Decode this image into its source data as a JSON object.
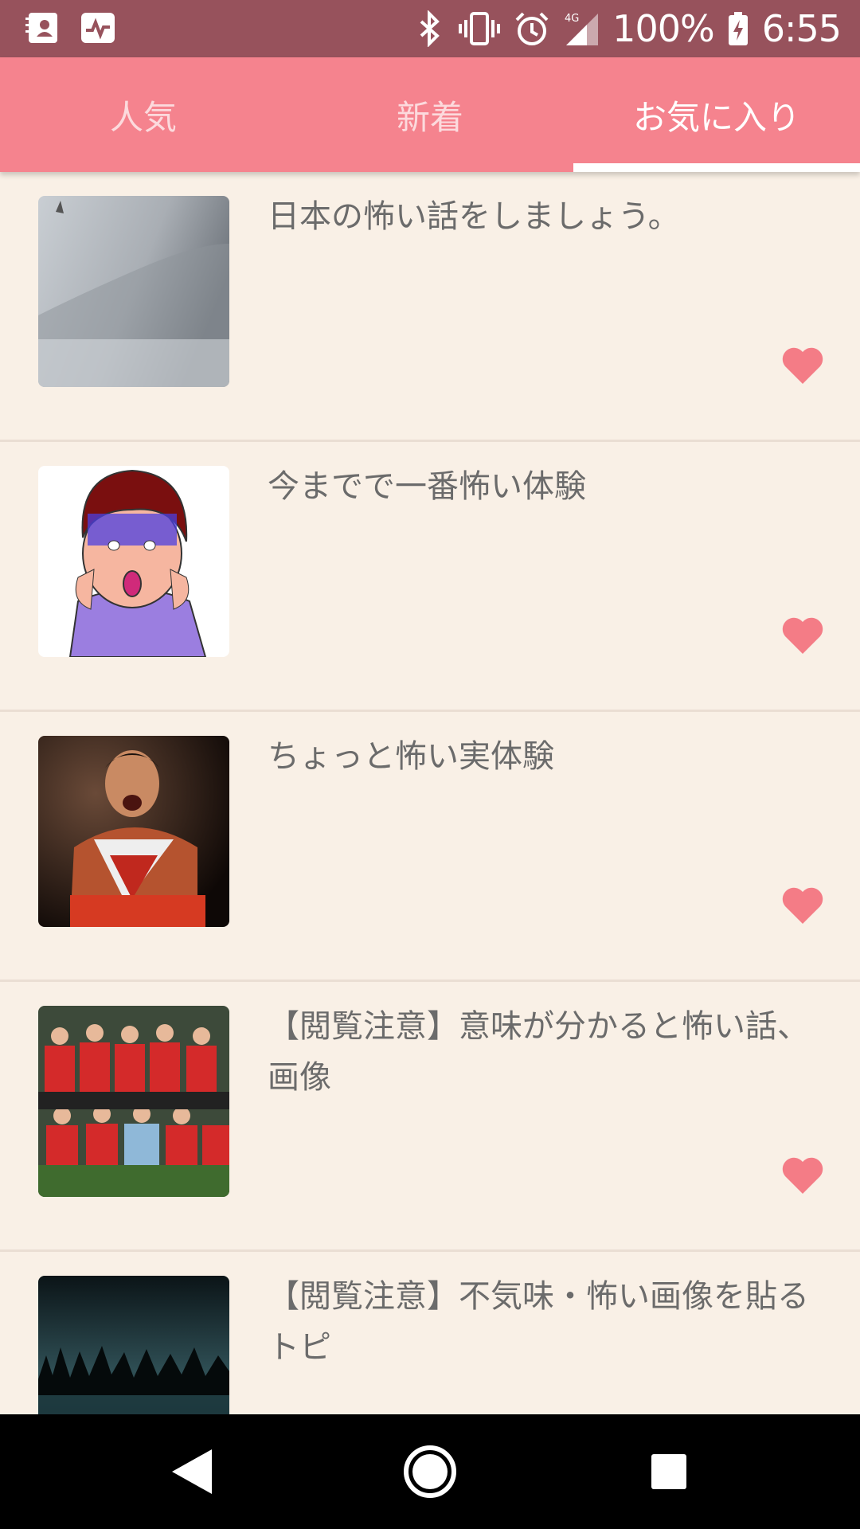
{
  "status": {
    "battery": "100%",
    "time": "6:55",
    "network": "4G",
    "icons": [
      "contacts-icon",
      "activity-icon",
      "bluetooth-icon",
      "vibrate-icon",
      "alarm-icon",
      "signal-icon",
      "battery-icon"
    ]
  },
  "tabs": [
    {
      "label": "人気"
    },
    {
      "label": "新着"
    },
    {
      "label": "お気に入り",
      "active": true
    }
  ],
  "items": [
    {
      "title": "日本の怖い話をしましょう。",
      "thumbnail": "misty-landscape-photo",
      "favorited": true
    },
    {
      "title": "今までで一番怖い体験",
      "thumbnail": "screaming-cartoon-drawing",
      "favorited": true
    },
    {
      "title": "ちょっと怖い実体験",
      "thumbnail": "shouting-man-photo",
      "favorited": true
    },
    {
      "title": "【閲覧注意】意味が分かると怖い話、画像",
      "thumbnail": "soccer-team-photo",
      "favorited": true
    },
    {
      "title": "【閲覧注意】不気味・怖い画像を貼るトピ",
      "thumbnail": "dark-forest-photo",
      "favorited": false
    }
  ],
  "colors": {
    "status_bar": "#97525c",
    "accent": "#f5838e",
    "background": "#f9f0e6",
    "heart": "#f47c86",
    "text": "#6b6b6b"
  },
  "nav": {
    "buttons": [
      "back-icon",
      "home-icon",
      "recents-icon"
    ]
  }
}
